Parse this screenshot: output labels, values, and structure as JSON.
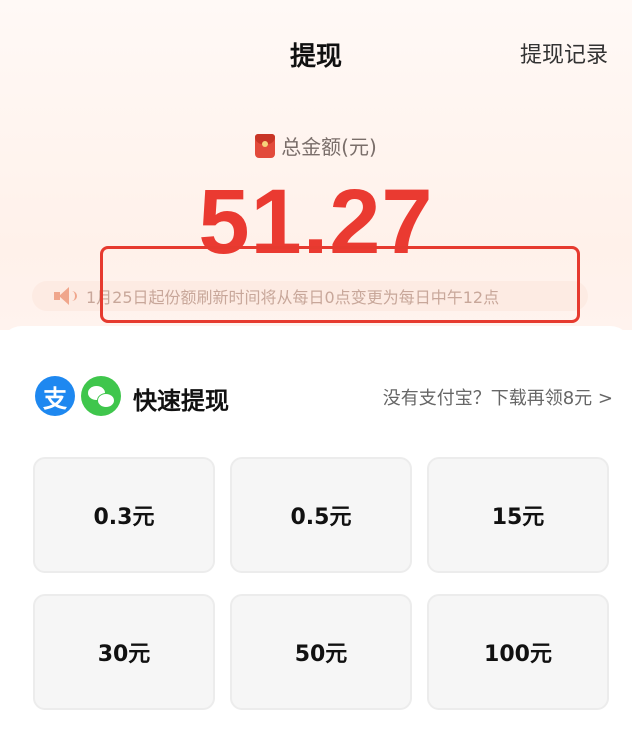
{
  "header": {
    "title": "提现",
    "history_link": "提现记录"
  },
  "balance": {
    "label": "总金额(元)",
    "amount": "51.27"
  },
  "notice": {
    "text": "1月25日起份额刷新时间将从每日0点变更为每日中午12点"
  },
  "quick_withdraw": {
    "alipay_glyph": "支",
    "title": "快速提现",
    "promo": "没有支付宝？下载再领8元 >"
  },
  "options": [
    {
      "label": "0.3元"
    },
    {
      "label": "0.5元"
    },
    {
      "label": "15元"
    },
    {
      "label": "30元"
    },
    {
      "label": "50元"
    },
    {
      "label": "100元"
    }
  ],
  "colors": {
    "accent_red": "#ea3a31",
    "highlight_border": "#e63a2f",
    "alipay_blue": "#1e88f0",
    "wechat_green": "#3fc64c"
  }
}
